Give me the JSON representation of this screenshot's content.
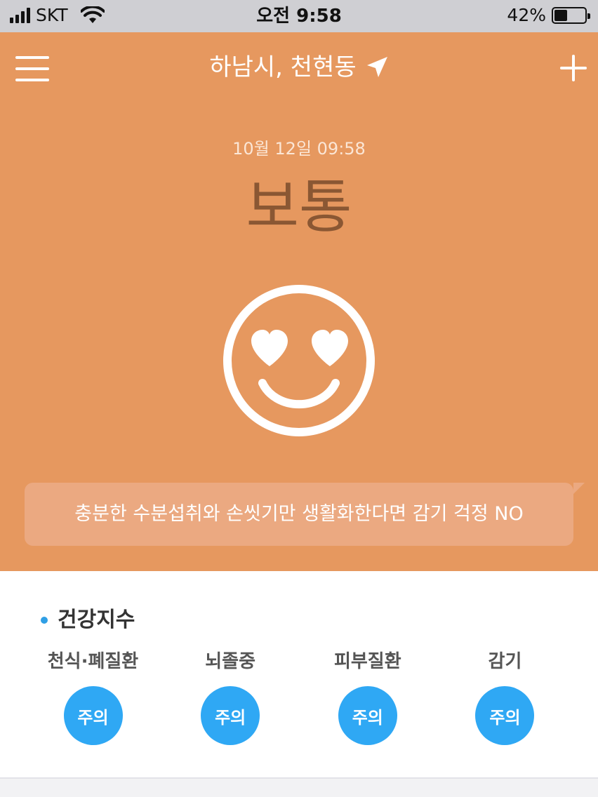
{
  "status_bar": {
    "carrier": "SKT",
    "time": "오전 9:58",
    "battery_percent": "42%",
    "battery_level": 0.42,
    "icons": [
      "signal-icon",
      "wifi-icon",
      "battery-icon"
    ]
  },
  "header": {
    "location": "하남시, 천현동",
    "menu_icon": "hamburger-menu-icon",
    "location_icon": "location-arrow-icon",
    "add_icon": "plus-icon"
  },
  "hero": {
    "datetime": "10월 12일 09:58",
    "grade": "보통",
    "face_icon": "heart-eyes-smiley-icon",
    "tip": "충분한 수분섭취와 손씻기만 생활화한다면 감기 걱정 NO",
    "background_color": "#e6985f",
    "grade_color": "#8a5733"
  },
  "health_index": {
    "title": "건강지수",
    "accent_color": "#2fa8f4",
    "items": [
      {
        "label": "천식·폐질환",
        "status": "주의"
      },
      {
        "label": "뇌졸중",
        "status": "주의"
      },
      {
        "label": "피부질환",
        "status": "주의"
      },
      {
        "label": "감기",
        "status": "주의"
      }
    ]
  }
}
